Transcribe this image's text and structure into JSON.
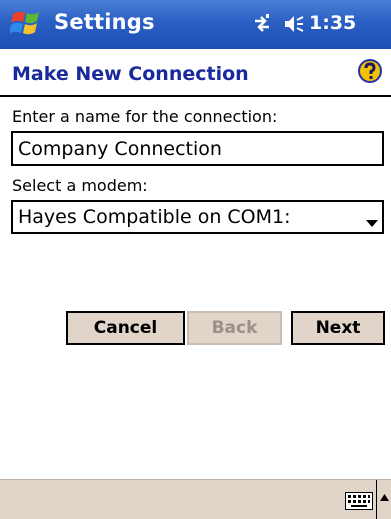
{
  "titlebar": {
    "app_title": "Settings",
    "time": "1:35"
  },
  "header": {
    "title": "Make New Connection"
  },
  "form": {
    "name_label": "Enter a name for the connection:",
    "name_value": "Company Connection",
    "modem_label": "Select a modem:",
    "modem_selected": "Hayes Compatible on COM1:"
  },
  "buttons": {
    "cancel": "Cancel",
    "back": "Back",
    "next": "Next"
  },
  "colors": {
    "titlebar": "#2a5fc4",
    "header_text": "#1a2a9c",
    "button_face": "#e1d4c8"
  }
}
